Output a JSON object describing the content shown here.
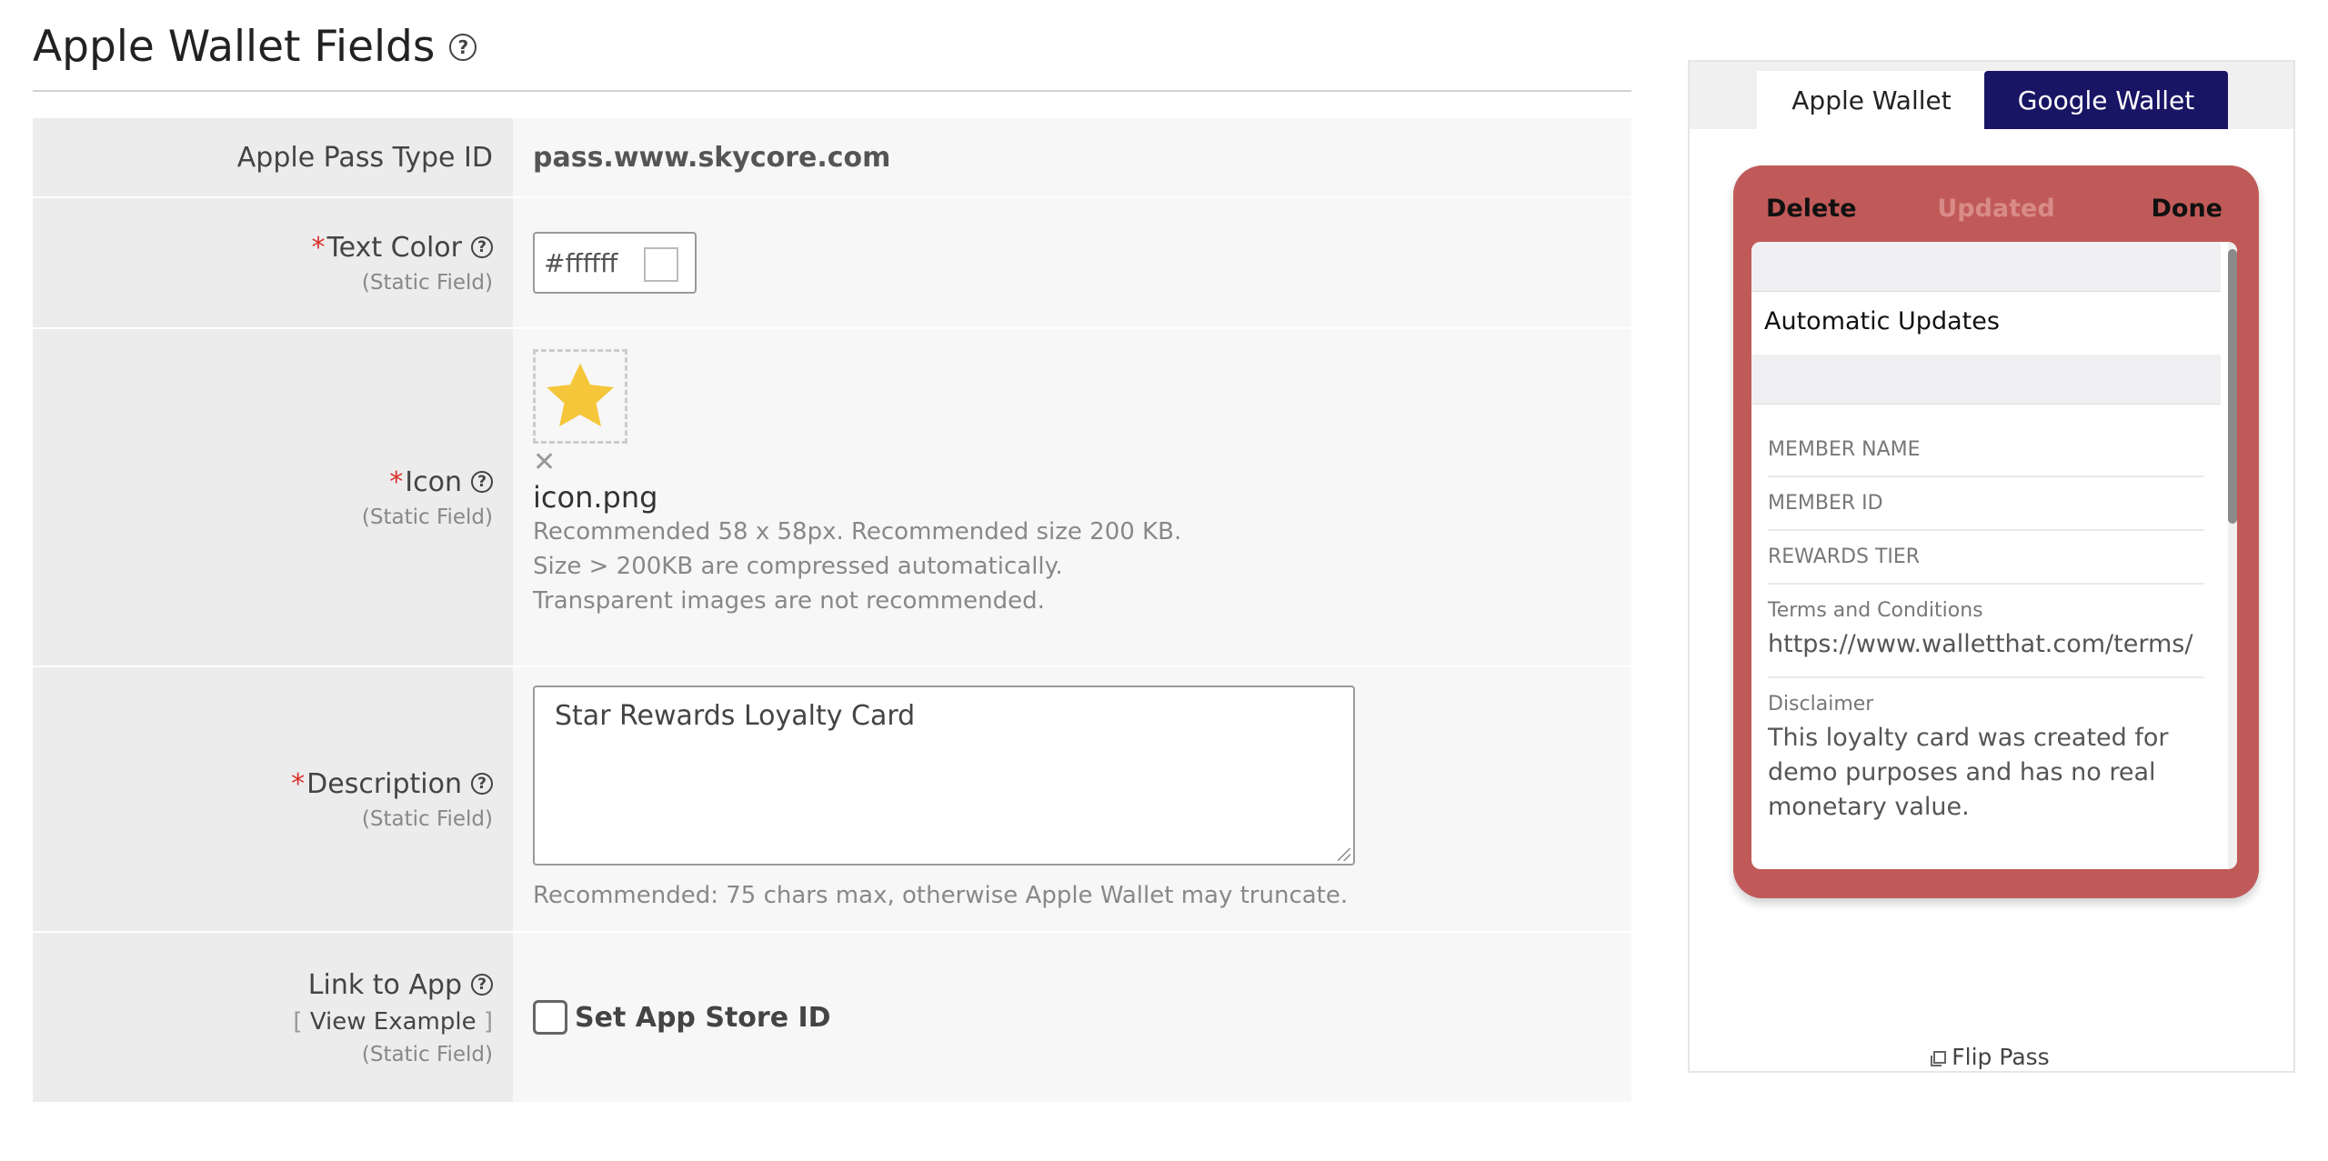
{
  "page": {
    "title": "Apple Wallet Fields"
  },
  "form": {
    "pass_type": {
      "label": "Apple Pass Type ID",
      "value": "pass.www.skycore.com"
    },
    "text_color": {
      "required": "*",
      "label": "Text Color",
      "sublabel": "(Static Field)",
      "value": "#ffffff",
      "swatch_color": "#ffffff"
    },
    "icon": {
      "required": "*",
      "label": "Icon",
      "sublabel": "(Static Field)",
      "remove": "✕",
      "filename": "icon.png",
      "hints": [
        "Recommended 58 x 58px. Recommended size 200 KB.",
        "Size > 200KB are compressed automatically.",
        "Transparent images are not recommended."
      ],
      "icon_name": "star-icon",
      "icon_color": "#f5c63a"
    },
    "description": {
      "required": "*",
      "label": "Description",
      "sublabel": "(Static Field)",
      "value": "Star Rewards Loyalty Card",
      "hint": "Recommended: 75 chars max, otherwise Apple Wallet may truncate."
    },
    "link_to_app": {
      "label": "Link to App",
      "view_example": "View Example",
      "bracket_open": "[",
      "bracket_close": "]",
      "sublabel": "(Static Field)",
      "checkbox_label": "Set App Store ID",
      "checked": false
    }
  },
  "preview": {
    "tabs": [
      {
        "label": "Apple Wallet",
        "active": true
      },
      {
        "label": "Google Wallet",
        "active": false
      }
    ],
    "card_color": "#c05a58",
    "header": {
      "delete": "Delete",
      "updated": "Updated",
      "done": "Done"
    },
    "automatic_updates": "Automatic Updates",
    "fields": [
      {
        "label": "MEMBER NAME",
        "value": ""
      },
      {
        "label": "MEMBER ID",
        "value": ""
      },
      {
        "label": "REWARDS TIER",
        "value": ""
      },
      {
        "label": "Terms and Conditions",
        "value": "https://www.walletthat.com/terms/"
      },
      {
        "label": "Disclaimer",
        "value": "This loyalty card was created for demo purposes and has no real monetary value."
      }
    ],
    "flip": "Flip Pass"
  }
}
